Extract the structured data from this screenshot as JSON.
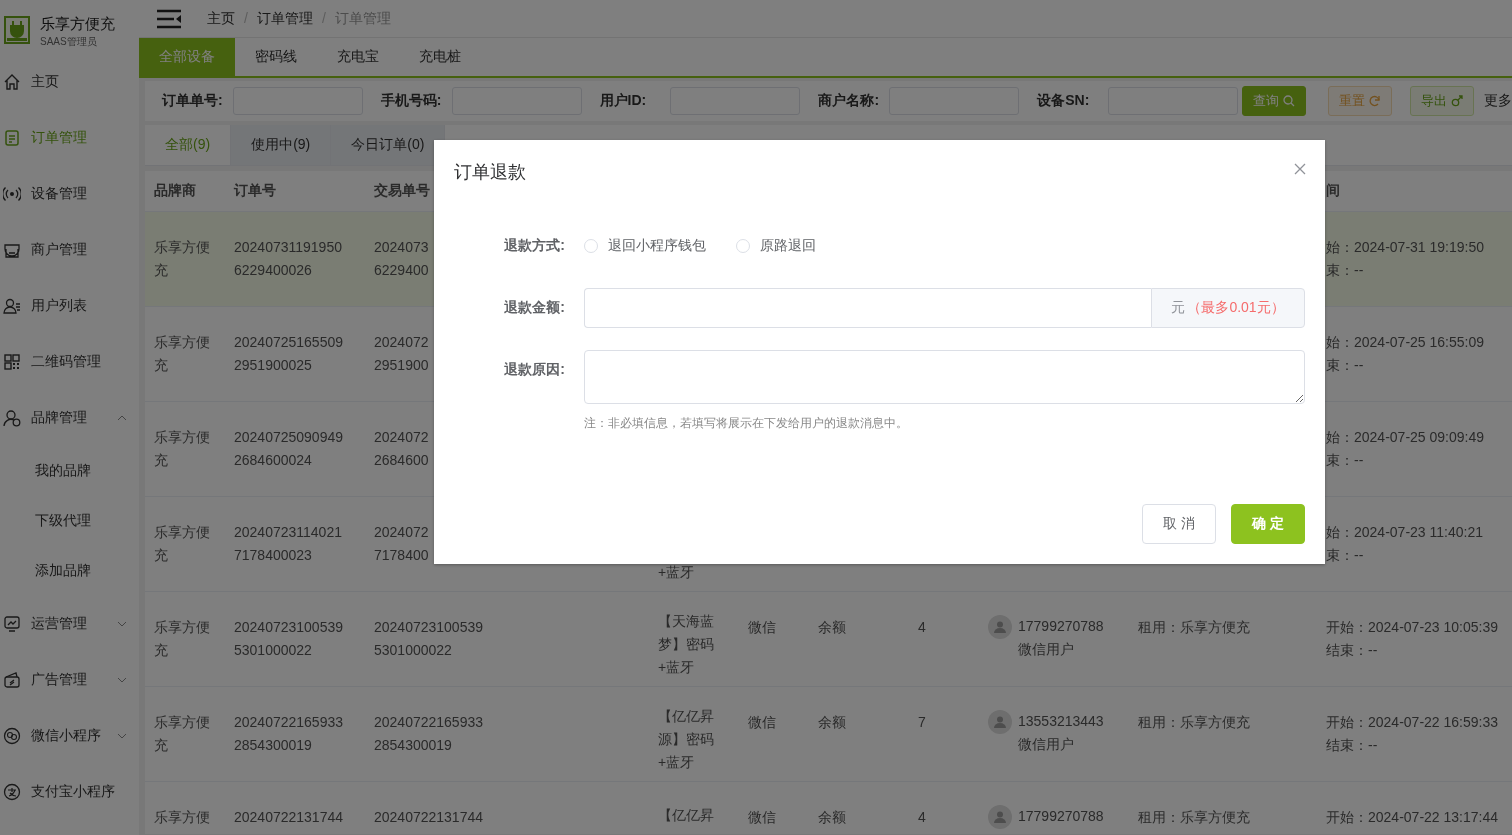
{
  "brand": {
    "name": "乐享方便充",
    "role": "SAAS管理员"
  },
  "sidebar": {
    "items": [
      {
        "label": "主页",
        "selected": false
      },
      {
        "label": "订单管理",
        "selected": true
      },
      {
        "label": "设备管理",
        "selected": false
      },
      {
        "label": "商户管理",
        "selected": false
      },
      {
        "label": "用户列表",
        "selected": false
      },
      {
        "label": "二维码管理",
        "selected": false
      },
      {
        "label": "品牌管理",
        "selected": false,
        "expanded": true,
        "children": [
          {
            "label": "我的品牌",
            "selected": false
          },
          {
            "label": "下级代理",
            "selected": false
          },
          {
            "label": "添加品牌",
            "selected": false
          }
        ]
      },
      {
        "label": "运营管理",
        "selected": false,
        "expanded": false
      },
      {
        "label": "广告管理",
        "selected": false,
        "expanded": false
      },
      {
        "label": "微信小程序",
        "selected": false,
        "expanded": false
      },
      {
        "label": "支付宝小程序",
        "selected": false
      }
    ]
  },
  "breadcrumb": {
    "items": [
      "主页",
      "订单管理",
      "订单管理"
    ],
    "separator": "/"
  },
  "device_tabs": [
    {
      "label": "全部设备",
      "selected": true
    },
    {
      "label": "密码线",
      "selected": false
    },
    {
      "label": "充电宝",
      "selected": false
    },
    {
      "label": "充电桩",
      "selected": false
    }
  ],
  "filters": [
    {
      "label": "订单单号:"
    },
    {
      "label": "手机号码:"
    },
    {
      "label": "用户ID:"
    },
    {
      "label": "商户名称:"
    },
    {
      "label": "设备SN:"
    }
  ],
  "filter_buttons": [
    {
      "label": "查询",
      "kind": "primary"
    },
    {
      "label": "重置",
      "kind": "warning"
    },
    {
      "label": "导出",
      "kind": "success"
    }
  ],
  "more_link": "更多",
  "order_tabs": [
    {
      "label": "全部(9)",
      "selected": true
    },
    {
      "label": "使用中(9)",
      "selected": false
    },
    {
      "label": "今日订单(0)",
      "selected": false
    }
  ],
  "table": {
    "columns": {
      "brand": "品牌商",
      "order_no": "订单号",
      "trade_no": "交易单号",
      "time": "间"
    },
    "rows": [
      {
        "selected": true,
        "brand": "乐享方便充",
        "order_no": [
          "20240731191950",
          "6229400026"
        ],
        "trade_no": [
          "2024073",
          "6229400"
        ],
        "start": "始：2024-07-31 19:19:50",
        "end": "束：--"
      },
      {
        "selected": false,
        "brand": "乐享方便充",
        "order_no": [
          "20240725165509",
          "2951900025"
        ],
        "trade_no": [
          "2024072",
          "2951900"
        ],
        "start": "始：2024-07-25 16:55:09",
        "end": "束：--"
      },
      {
        "selected": false,
        "brand": "乐享方便充",
        "order_no": [
          "20240725090949",
          "2684600024"
        ],
        "trade_no": [
          "2024072",
          "2684600"
        ],
        "start": "始：2024-07-25 09:09:49",
        "end": "束：--"
      },
      {
        "selected": false,
        "brand": "乐享方便充",
        "order_no": [
          "20240723114021",
          "7178400023"
        ],
        "trade_no": [
          "2024072",
          "7178400"
        ],
        "device": [
          "+蓝牙"
        ],
        "start": "始：2024-07-23 11:40:21",
        "end": "束：--"
      },
      {
        "selected": false,
        "brand": "乐享方便充",
        "order_no": [
          "20240723100539",
          "5301000022"
        ],
        "trade_no": [
          "20240723100539",
          "5301000022"
        ],
        "device": [
          "【天海蓝",
          "梦】密码",
          "+蓝牙"
        ],
        "pay": "微信",
        "kind": "余额",
        "count": "4",
        "user": [
          "17799270788",
          "微信用户"
        ],
        "rent": "租用：乐享方便充",
        "start": "开始：2024-07-23 10:05:39",
        "end": "结束：--"
      },
      {
        "selected": false,
        "brand": "乐享方便充",
        "order_no": [
          "20240722165933",
          "2854300019"
        ],
        "trade_no": [
          "20240722165933",
          "2854300019"
        ],
        "device": [
          "【亿亿昇",
          "源】密码",
          "+蓝牙"
        ],
        "pay": "微信",
        "kind": "余额",
        "count": "7",
        "user": [
          "13553213443",
          "微信用户"
        ],
        "rent": "租用：乐享方便充",
        "start": "开始：2024-07-22 16:59:33",
        "end": "结束：--"
      },
      {
        "selected": false,
        "brand": "乐享方便",
        "order_no": [
          "20240722131744"
        ],
        "trade_no": [
          "20240722131744"
        ],
        "device": [
          "【亿亿昇"
        ],
        "pay": "微信",
        "kind": "余额",
        "count": "4",
        "user": [
          "17799270788"
        ],
        "rent": "租用：乐享方便充",
        "start": "开始：2024-07-22 13:17:44"
      }
    ]
  },
  "dialog": {
    "title": "订单退款",
    "method": {
      "label": "退款方式:",
      "options": [
        {
          "label": "退回小程序钱包",
          "selected": false
        },
        {
          "label": "原路退回",
          "selected": false
        }
      ]
    },
    "amount": {
      "label": "退款金额:",
      "unit": "元",
      "hint": "（最多0.01元）"
    },
    "reason": {
      "label": "退款原因:",
      "note": "注：非必填信息，若填写将展示在下发给用户的退款消息中。"
    },
    "buttons": [
      {
        "label": "取 消",
        "kind": "default"
      },
      {
        "label": "确 定",
        "kind": "primary"
      }
    ]
  }
}
